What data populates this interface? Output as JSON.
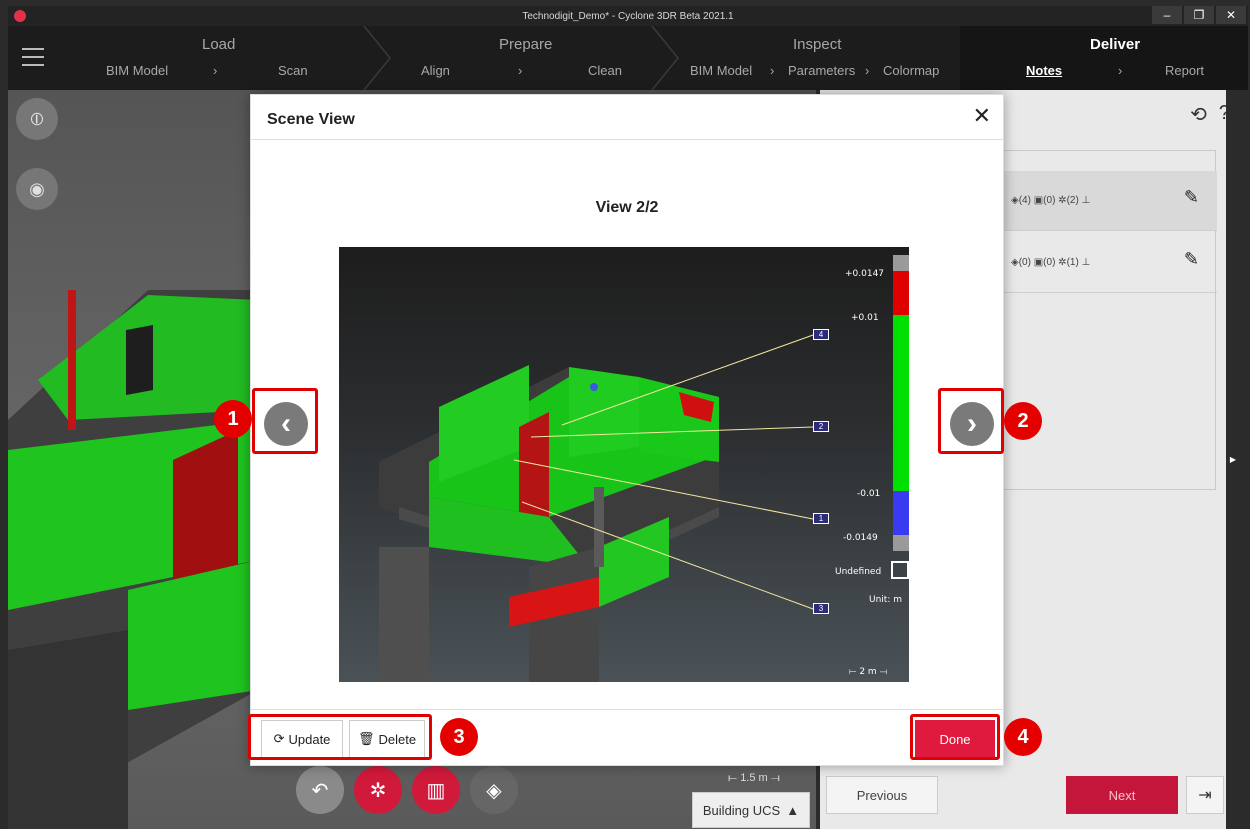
{
  "window": {
    "title": "Technodigit_Demo* - Cyclone 3DR Beta 2021.1",
    "controls": [
      "–",
      "❐",
      "✕"
    ]
  },
  "workflow": {
    "groups": [
      {
        "title": "Load",
        "items": [
          "BIM Model",
          "Scan"
        ]
      },
      {
        "title": "Prepare",
        "items": [
          "Align",
          "Clean"
        ]
      },
      {
        "title": "Inspect",
        "items": [
          "BIM Model",
          "Parameters",
          "Colormap"
        ]
      },
      {
        "title": "Deliver",
        "items": [
          "Notes",
          "Report"
        ]
      }
    ],
    "chevron": "›"
  },
  "right_panel": {
    "notes": [
      {
        "tags": "(4)",
        "photos": "(0)",
        "annotations": "(2)"
      },
      {
        "tags": "(0)",
        "photos": "(0)",
        "annotations": "(1)"
      }
    ],
    "previous_label": "Previous",
    "next_label": "Next"
  },
  "viewport": {
    "scale_label": "1.5 m",
    "ucs_label": "Building UCS"
  },
  "modal": {
    "title": "Scene View",
    "close_glyph": "✕",
    "view_label": "View 2/2",
    "update_label": "Update",
    "delete_label": "Delete",
    "done_label": "Done"
  },
  "colorbar": {
    "max": "+0.0147",
    "upper": "+0.01",
    "lower": "-0.01",
    "min": "-0.0149",
    "undefined_label": "Undefined",
    "unit": "Unit: m",
    "scale": "2 m",
    "colors": {
      "above": "#e00000",
      "within": "#00e000",
      "below": "#3a3af0",
      "out": "#9a9a9a"
    }
  },
  "snapshot_tags": [
    "4",
    "2",
    "1",
    "3"
  ],
  "callouts": [
    "1",
    "2",
    "3",
    "4"
  ],
  "colors": {
    "accent": "#e0193f",
    "callout": "#e50000",
    "deviation_ok": "#1fc41f"
  }
}
